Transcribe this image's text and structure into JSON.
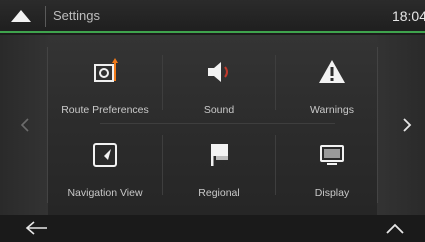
{
  "header": {
    "title": "Settings",
    "clock": "18:04"
  },
  "tiles": [
    {
      "label": "Route Preferences",
      "icon": "route-preferences-icon"
    },
    {
      "label": "Sound",
      "icon": "speaker-icon"
    },
    {
      "label": "Warnings",
      "icon": "warning-icon"
    },
    {
      "label": "Navigation View",
      "icon": "navigation-view-icon"
    },
    {
      "label": "Regional",
      "icon": "flag-icon"
    },
    {
      "label": "Display",
      "icon": "display-icon"
    }
  ],
  "colors": {
    "accent_green": "#3fa34d",
    "accent_orange": "#f07a1a",
    "accent_red": "#c0392b"
  }
}
